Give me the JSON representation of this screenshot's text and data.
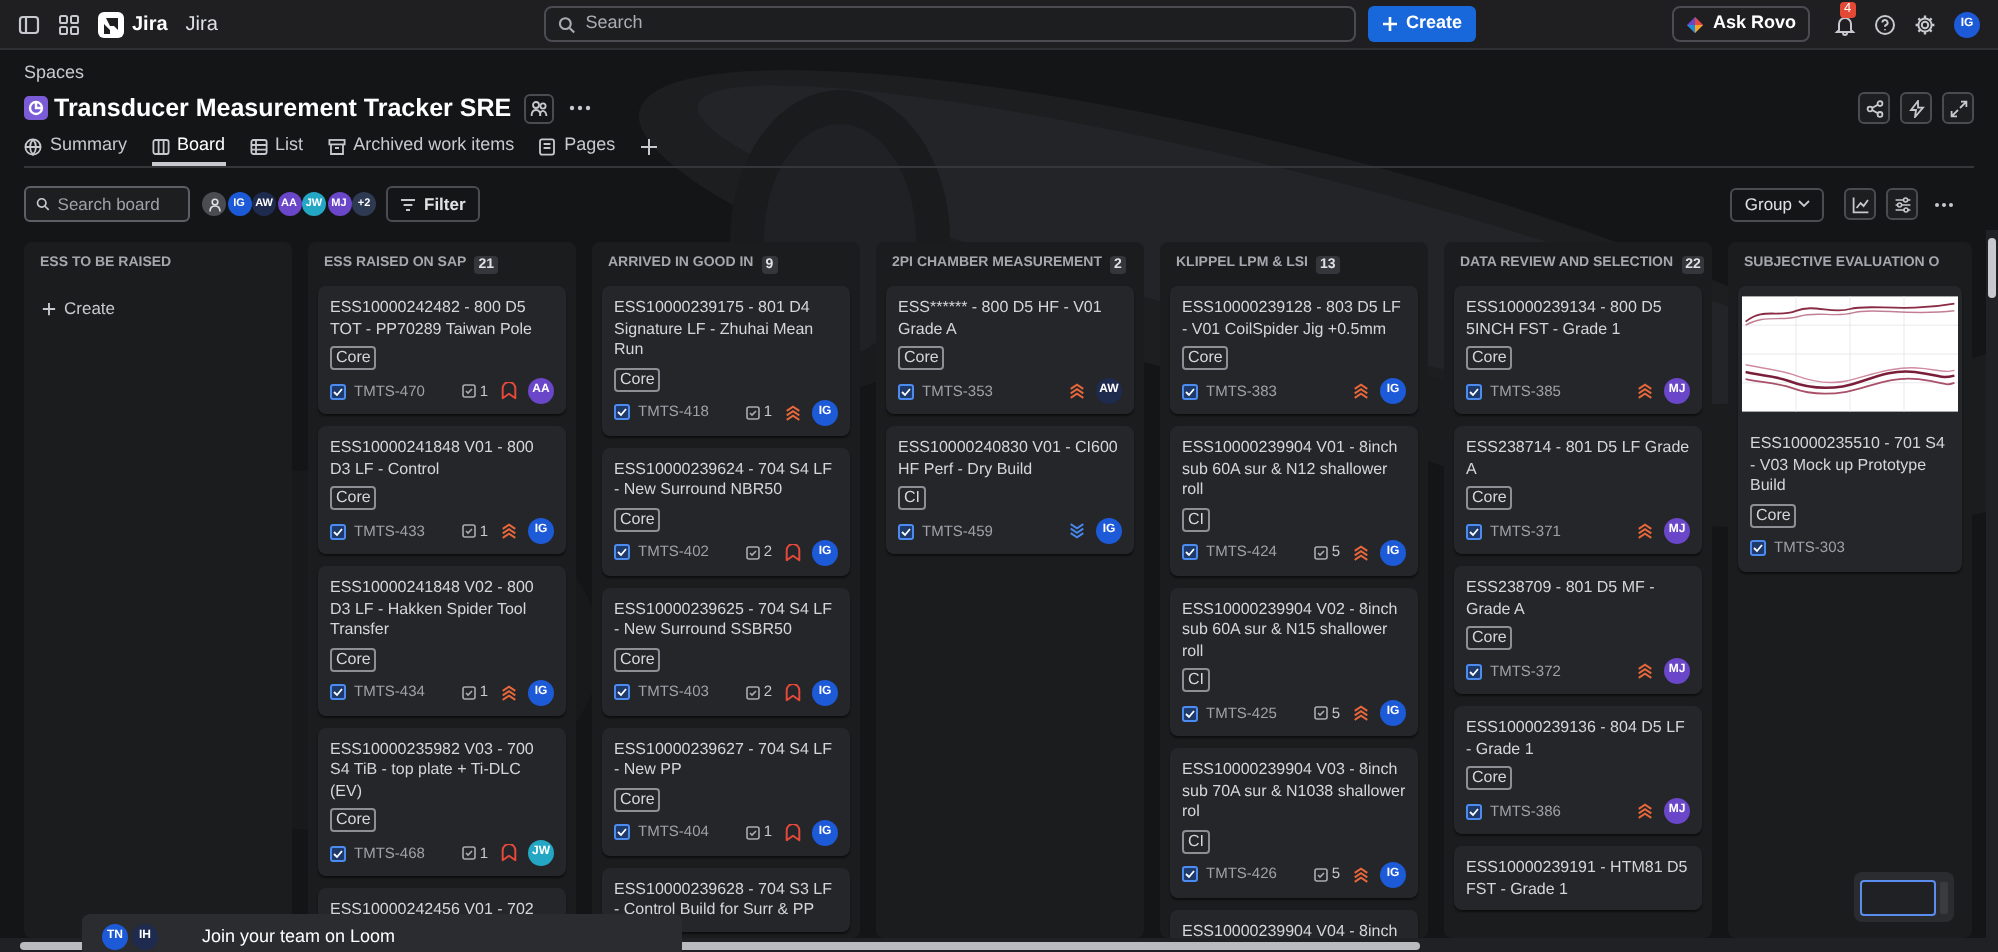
{
  "top_bar": {
    "app_name": "Jira",
    "app_label": "Jira",
    "search_placeholder": "Search",
    "create_label": "Create",
    "ask_rovo_label": "Ask Rovo",
    "notification_count": "4",
    "user_initials": "IG"
  },
  "header": {
    "breadcrumb": "Spaces",
    "title": "Transducer Measurement Tracker SRE"
  },
  "tabs": [
    {
      "label": "Summary",
      "kind": "summary",
      "selected": false
    },
    {
      "label": "Board",
      "kind": "board",
      "selected": true
    },
    {
      "label": "List",
      "kind": "list",
      "selected": false
    },
    {
      "label": "Archived work items",
      "kind": "archive",
      "selected": false
    },
    {
      "label": "Pages",
      "kind": "pages",
      "selected": false
    }
  ],
  "toolbar": {
    "search_placeholder": "Search board",
    "avatars": [
      {
        "initials": "IG",
        "color": "#1d5ad8"
      },
      {
        "initials": "AW",
        "color": "#1e2b4f"
      },
      {
        "initials": "AA",
        "color": "#6a46c8"
      },
      {
        "initials": "JW",
        "color": "#23a7c4"
      },
      {
        "initials": "MJ",
        "color": "#6a46c8"
      }
    ],
    "more_count": "+2",
    "filter_label": "Filter",
    "group_label": "Group"
  },
  "columns": [
    {
      "title": "ESS TO BE RAISED",
      "create_label": "Create"
    },
    {
      "title": "ESS RAISED ON SAP",
      "count": "21",
      "cards": [
        {
          "title": "ESS10000242482 - 800 D5 TOT - PP70289 Taiwan Pole",
          "tag": "Core",
          "key": "TMTS-470",
          "subtasks": "1",
          "priority": {
            "kind": "highest"
          },
          "assignee": {
            "initials": "AA",
            "color": "#6a46c8"
          }
        },
        {
          "title": "ESS10000241848 V01 - 800 D3 LF - Control",
          "tag": "Core",
          "key": "TMTS-433",
          "subtasks": "1",
          "priority": {
            "kind": "high"
          },
          "assignee": {
            "initials": "IG",
            "color": "#1d5ad8"
          }
        },
        {
          "title": "ESS10000241848 V02 - 800 D3 LF - Hakken Spider Tool Transfer",
          "tag": "Core",
          "key": "TMTS-434",
          "subtasks": "1",
          "priority": {
            "kind": "high"
          },
          "assignee": {
            "initials": "IG",
            "color": "#1d5ad8"
          }
        },
        {
          "title": "ESS10000235982 V03 - 700 S4 TiB - top plate + Ti-DLC (EV)",
          "tag": "Core",
          "key": "TMTS-468",
          "subtasks": "1",
          "priority": {
            "kind": "highest"
          },
          "assignee": {
            "initials": "JW",
            "color": "#23a7c4"
          }
        },
        {
          "title": "ESS10000242456 V01 - 702"
        }
      ]
    },
    {
      "title": "ARRIVED IN GOOD IN",
      "count": "9",
      "cards": [
        {
          "title": "ESS10000239175 - 801 D4 Signature LF - Zhuhai Mean Run",
          "tag": "Core",
          "key": "TMTS-418",
          "subtasks": "1",
          "priority": {
            "kind": "high"
          },
          "assignee": {
            "initials": "IG",
            "color": "#1d5ad8"
          }
        },
        {
          "title": "ESS10000239624 - 704 S4 LF - New Surround NBR50",
          "tag": "Core",
          "key": "TMTS-402",
          "subtasks": "2",
          "priority": {
            "kind": "highest"
          },
          "assignee": {
            "initials": "IG",
            "color": "#1d5ad8"
          }
        },
        {
          "title": "ESS10000239625 - 704 S4 LF - New Surround SSBR50",
          "tag": "Core",
          "key": "TMTS-403",
          "subtasks": "2",
          "priority": {
            "kind": "highest"
          },
          "assignee": {
            "initials": "IG",
            "color": "#1d5ad8"
          }
        },
        {
          "title": "ESS10000239627 - 704 S4 LF - New PP",
          "tag": "Core",
          "key": "TMTS-404",
          "subtasks": "1",
          "priority": {
            "kind": "highest"
          },
          "assignee": {
            "initials": "IG",
            "color": "#1d5ad8"
          }
        },
        {
          "title": "ESS10000239628 - 704 S3 LF - Control Build for Surr & PP"
        }
      ]
    },
    {
      "title": "2PI CHAMBER MEASUREMENT",
      "count": "2",
      "cards": [
        {
          "title": "ESS****** - 800 D5 HF - V01 Grade A",
          "tag": "Core",
          "key": "TMTS-353",
          "priority": {
            "kind": "high"
          },
          "assignee": {
            "initials": "AW",
            "color": "#1e2b4f"
          }
        },
        {
          "title": "ESS10000240830 V01 - CI600 HF Perf - Dry Build",
          "tag": "CI",
          "key": "TMTS-459",
          "priority": {
            "kind": "low"
          },
          "assignee": {
            "initials": "IG",
            "color": "#1d5ad8"
          }
        }
      ]
    },
    {
      "title": "KLIPPEL LPM & LSI",
      "count": "13",
      "cards": [
        {
          "title": "ESS10000239128 - 803 D5 LF - V01 CoilSpider Jig +0.5mm",
          "tag": "Core",
          "key": "TMTS-383",
          "priority": {
            "kind": "high"
          },
          "assignee": {
            "initials": "IG",
            "color": "#1d5ad8"
          }
        },
        {
          "title": "ESS10000239904 V01 - 8inch sub 60A sur & N12 shallower roll",
          "tag": "CI",
          "key": "TMTS-424",
          "subtasks": "5",
          "priority": {
            "kind": "high"
          },
          "assignee": {
            "initials": "IG",
            "color": "#1d5ad8"
          }
        },
        {
          "title": "ESS10000239904 V02 - 8inch sub 60A sur & N15 shallower roll",
          "tag": "CI",
          "key": "TMTS-425",
          "subtasks": "5",
          "priority": {
            "kind": "high"
          },
          "assignee": {
            "initials": "IG",
            "color": "#1d5ad8"
          }
        },
        {
          "title": "ESS10000239904 V03 - 8inch sub 70A sur & N1038 shallower rol",
          "tag": "CI",
          "key": "TMTS-426",
          "subtasks": "5",
          "priority": {
            "kind": "high"
          },
          "assignee": {
            "initials": "IG",
            "color": "#1d5ad8"
          }
        },
        {
          "title": "ESS10000239904 V04 - 8inch"
        }
      ]
    },
    {
      "title": "DATA REVIEW AND SELECTION",
      "count": "22",
      "cards": [
        {
          "title": "ESS10000239134 - 800 D5 5INCH FST - Grade 1",
          "tag": "Core",
          "key": "TMTS-385",
          "priority": {
            "kind": "high"
          },
          "assignee": {
            "initials": "MJ",
            "color": "#6a46c8"
          }
        },
        {
          "title": "ESS238714 - 801 D5 LF Grade A",
          "tag": "Core",
          "key": "TMTS-371",
          "priority": {
            "kind": "high"
          },
          "assignee": {
            "initials": "MJ",
            "color": "#6a46c8"
          }
        },
        {
          "title": "ESS238709 - 801 D5 MF - Grade A",
          "tag": "Core",
          "key": "TMTS-372",
          "priority": {
            "kind": "high"
          },
          "assignee": {
            "initials": "MJ",
            "color": "#6a46c8"
          }
        },
        {
          "title": "ESS10000239136 - 804 D5 LF - Grade 1",
          "tag": "Core",
          "key": "TMTS-386",
          "priority": {
            "kind": "high"
          },
          "assignee": {
            "initials": "MJ",
            "color": "#6a46c8"
          }
        },
        {
          "title": "ESS10000239191 - HTM81 D5 FST - Grade 1"
        }
      ]
    },
    {
      "title": "SUBJECTIVE EVALUATION O",
      "cards": [
        {
          "kind": "picture",
          "title": "ESS10000235510 - 701 S4 - V03 Mock up Prototype Build",
          "tag": "Core",
          "key": "TMTS-303"
        }
      ]
    }
  ],
  "loom_prompt": {
    "avatars": [
      {
        "initials": "TN",
        "color": "#1d5ad8"
      },
      {
        "initials": "IH",
        "color": "#1e2b4f"
      }
    ],
    "message": "Join your team on Loom"
  }
}
